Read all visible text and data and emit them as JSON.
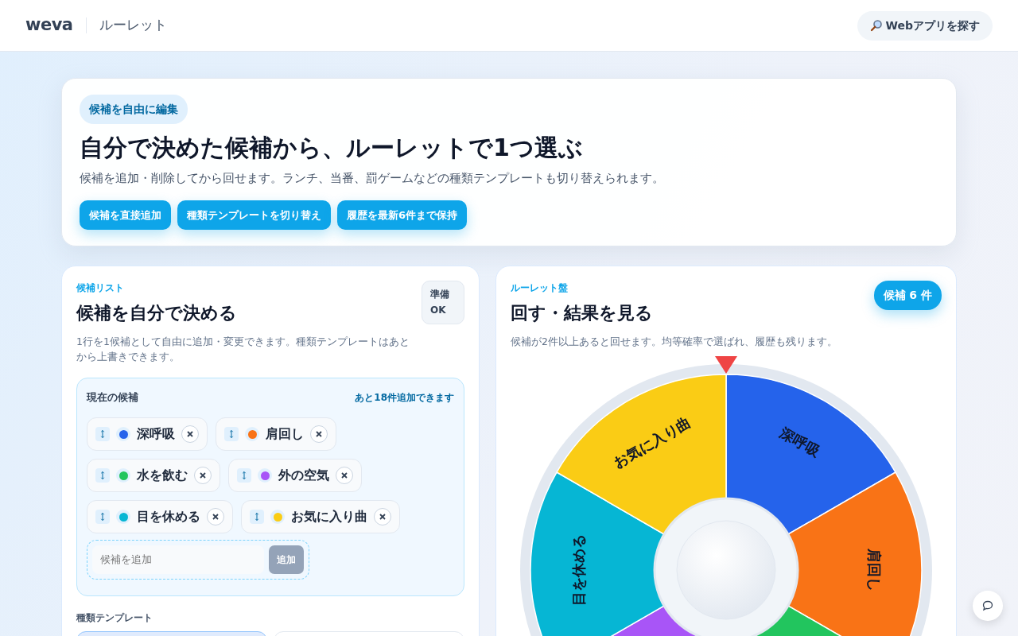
{
  "header": {
    "logo": "weva",
    "title": "ルーレット",
    "search_button": "Webアプリを探す"
  },
  "hero": {
    "badge": "候補を自由に編集",
    "title": "自分で決めた候補から、ルーレットで1つ選ぶ",
    "description": "候補を追加・削除してから回せます。ランチ、当番、罰ゲームなどの種類テンプレートも切り替えられます。",
    "buttons": [
      "候補を直接追加",
      "種類テンプレートを切り替え",
      "履歴を最新6件まで保持"
    ]
  },
  "candidate_panel": {
    "eyebrow": "候補リスト",
    "title": "候補を自分で決める",
    "status": "準備 OK",
    "description": "1行を1候補として自由に追加・変更できます。種類テンプレートはあとから上書きできます。",
    "current": {
      "label": "現在の候補",
      "remaining": "あと18件追加できます",
      "items": [
        {
          "label": "深呼吸",
          "color": "#2563eb"
        },
        {
          "label": "肩回し",
          "color": "#f97316"
        },
        {
          "label": "水を飲む",
          "color": "#22c55e"
        },
        {
          "label": "外の空気",
          "color": "#a855f7"
        },
        {
          "label": "目を休める",
          "color": "#06b6d4"
        },
        {
          "label": "お気に入り曲",
          "color": "#facc15"
        }
      ],
      "add_field": {
        "placeholder": "候補を追加"
      },
      "add_button": {
        "label": "追加",
        "disabled": true
      }
    },
    "templates_label": "種類テンプレート",
    "templates": [
      {
        "selected": true
      },
      {
        "selected": false
      }
    ]
  },
  "wheel_panel": {
    "eyebrow": "ルーレット盤",
    "title": "回す・結果を見る",
    "count_badge": "候補 6 件",
    "description": "候補が2件以上あると回せます。均等確率で選ばれ、履歴も残ります。",
    "segments": [
      {
        "label": "深呼吸",
        "color": "#2563eb"
      },
      {
        "label": "肩回し",
        "color": "#f97316"
      },
      {
        "color": "#22c55e"
      },
      {
        "color": "#a855f7"
      },
      {
        "label": "目を休める",
        "color": "#06b6d4"
      },
      {
        "label": "お気に入り曲",
        "color": "#facc15"
      }
    ]
  }
}
